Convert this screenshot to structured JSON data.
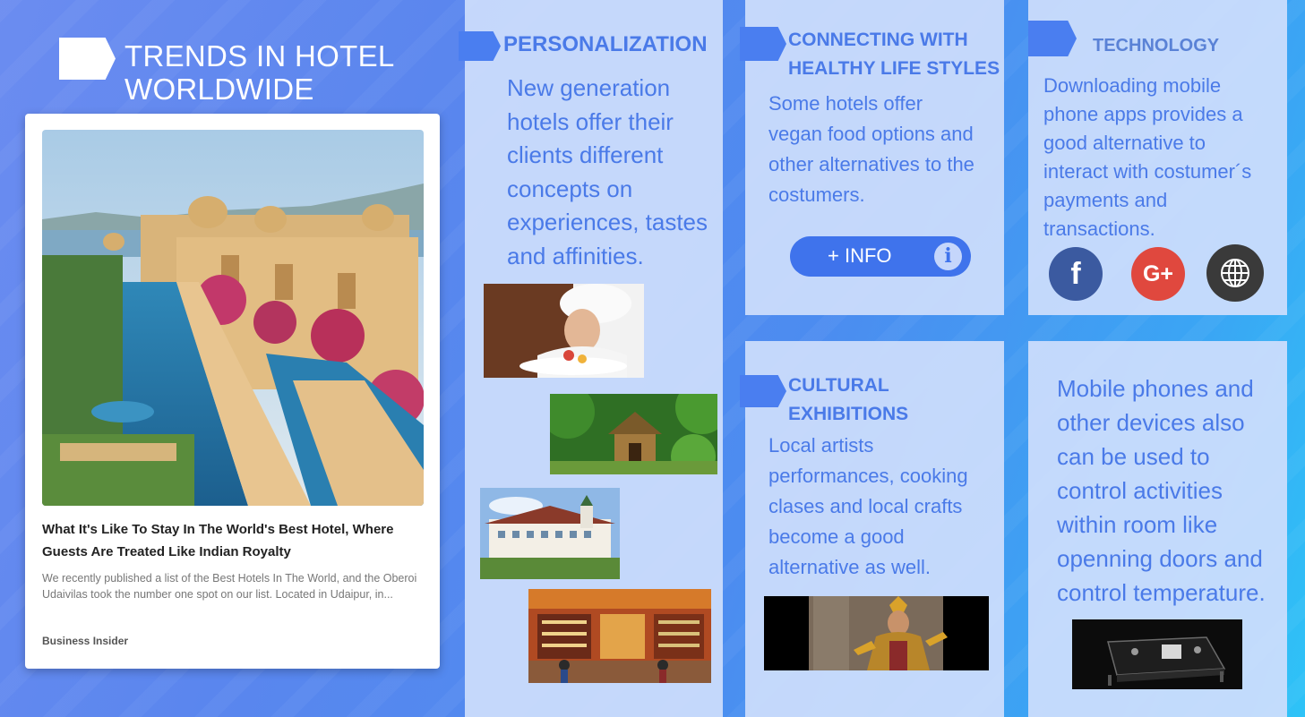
{
  "title": {
    "line1": "TRENDS IN HOTEL",
    "line2": "WORLDWIDE"
  },
  "article": {
    "headline": "What It's Like To Stay In The World's Best Hotel, Where Guests Are Treated Like Indian Royalty",
    "excerpt": "We recently published a list of the Best Hotels In The World, and the Oberoi Udaivilas took the number one spot on our list. Located in Udaipur, in...",
    "source": "Business Insider"
  },
  "personalization": {
    "heading": "PERSONALIZATION",
    "lines": [
      "New generation",
      "hotels offer their",
      "clients different",
      "concepts on",
      "experiences, tastes",
      "and affinities."
    ]
  },
  "healthy": {
    "heading_line1": "CONNECTING WITH",
    "heading_line2": "HEALTHY LIFE STYLES",
    "lines": [
      "Some hotels offer",
      "vegan food options and",
      "other alternatives to the",
      "costumers."
    ],
    "button_label": "+ INFO",
    "button_icon": "i"
  },
  "technology": {
    "heading": "TECHNOLOGY",
    "lines": [
      "Downloading mobile",
      "phone apps provides a",
      "good alternative to",
      "interact with costumer´s",
      "payments and",
      "transactions."
    ],
    "social": {
      "facebook_glyph": "f",
      "google_glyph": "G+",
      "colors": {
        "facebook": "#3b5aa0",
        "google": "#e0483e",
        "web": "#3a3a3a"
      }
    }
  },
  "cultural": {
    "heading_line1": "CULTURAL",
    "heading_line2": "EXHIBITIONS",
    "lines": [
      "Local artists",
      "performances, cooking",
      "clases and local crafts",
      "become a good",
      "alternative as well."
    ]
  },
  "mobile": {
    "lines": [
      "Mobile phones and",
      "other devices also",
      "can be used to",
      "control activities",
      "within room like",
      "openning doors and",
      "control temperature."
    ]
  },
  "colors": {
    "accent": "#4a7ae8",
    "panel": "#cddefc",
    "button": "#3f73ec"
  }
}
